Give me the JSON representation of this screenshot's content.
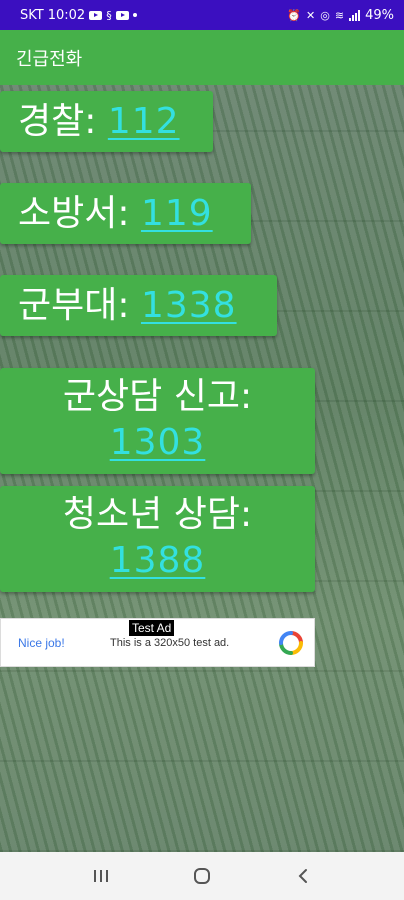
{
  "status_bar": {
    "carrier": "SKT",
    "time": "10:02",
    "battery": "49%"
  },
  "app_bar": {
    "title": "긴급전화"
  },
  "contacts": [
    {
      "label": "경찰:",
      "number": "112"
    },
    {
      "label": "소방서:",
      "number": "119"
    },
    {
      "label": "군부대:",
      "number": "1338"
    },
    {
      "label": "군상담 신고:",
      "number": "1303"
    },
    {
      "label": "청소년 상담:",
      "number": "1388"
    }
  ],
  "ad": {
    "tag": "Test Ad",
    "nice_job": "Nice job!",
    "text": "This is a 320x50 test ad."
  },
  "colors": {
    "status_bar": "#3b0fc0",
    "primary": "#46b04a",
    "number_link": "#33e0e0"
  },
  "icons": {
    "nav_recents": "recents-icon",
    "nav_home": "home-icon",
    "nav_back": "back-icon"
  }
}
